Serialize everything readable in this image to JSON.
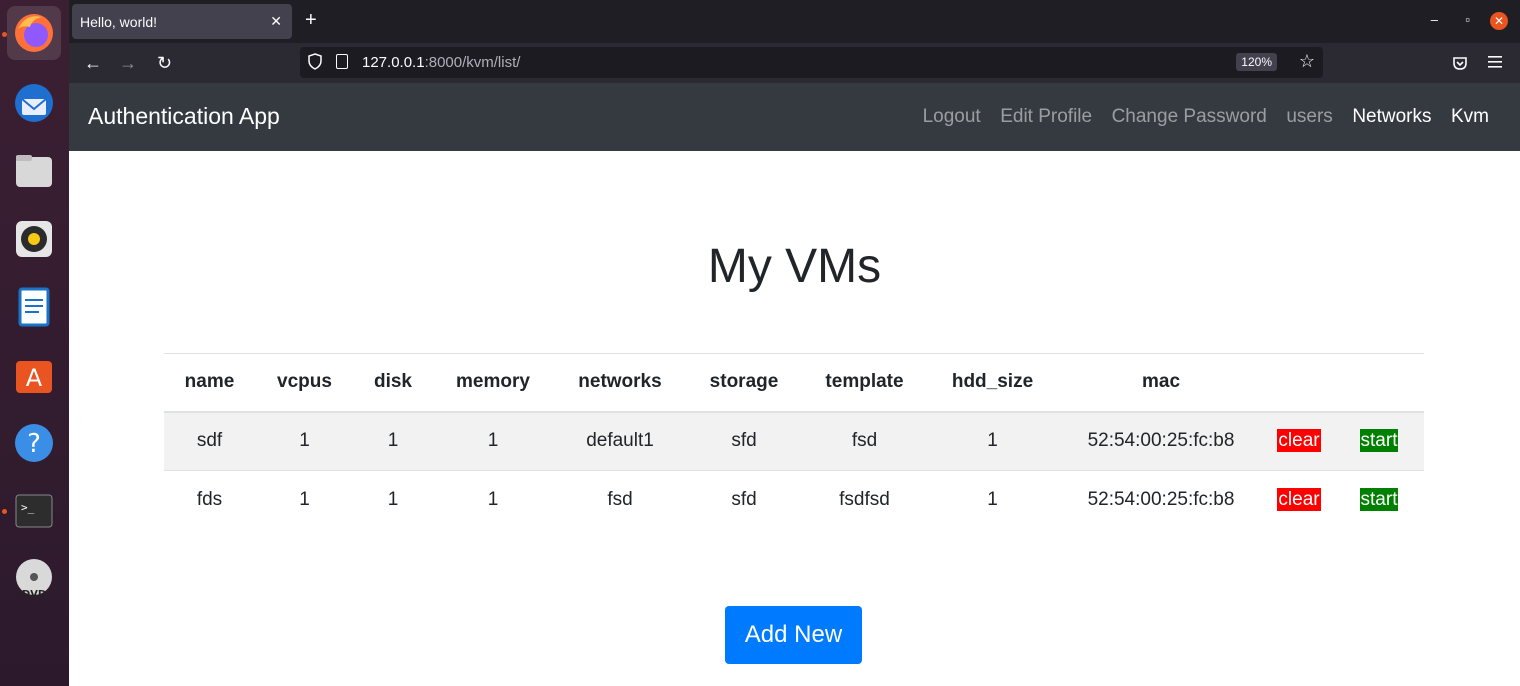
{
  "browser": {
    "tab_title": "Hello, world!",
    "url_host": "127.0.0.1",
    "url_path": ":8000/kvm/list/",
    "zoom": "120%"
  },
  "site": {
    "brand": "Authentication App",
    "links": [
      {
        "label": "Logout",
        "active": false
      },
      {
        "label": "Edit Profile",
        "active": false
      },
      {
        "label": "Change Password",
        "active": false
      },
      {
        "label": "users",
        "active": false
      },
      {
        "label": "Networks",
        "active": true
      },
      {
        "label": "Kvm",
        "active": true
      }
    ]
  },
  "page": {
    "title": "My VMs",
    "add_button": "Add New"
  },
  "table": {
    "headers": [
      "name",
      "vcpus",
      "disk",
      "memory",
      "networks",
      "storage",
      "template",
      "hdd_size",
      "mac"
    ],
    "rows": [
      {
        "name": "sdf",
        "vcpus": "1",
        "disk": "1",
        "memory": "1",
        "networks": "default1",
        "storage": "sfd",
        "template": "fsd",
        "hdd_size": "1",
        "mac": "52:54:00:25:fc:b8",
        "clear": "clear",
        "start": "start"
      },
      {
        "name": "fds",
        "vcpus": "1",
        "disk": "1",
        "memory": "1",
        "networks": "fsd",
        "storage": "sfd",
        "template": "fsdfsd",
        "hdd_size": "1",
        "mac": "52:54:00:25:fc:b8",
        "clear": "clear",
        "start": "start"
      }
    ]
  },
  "colors": {
    "clear": "#ff0000",
    "start": "#008000",
    "primary": "#007bff",
    "navbar": "#343a40"
  }
}
